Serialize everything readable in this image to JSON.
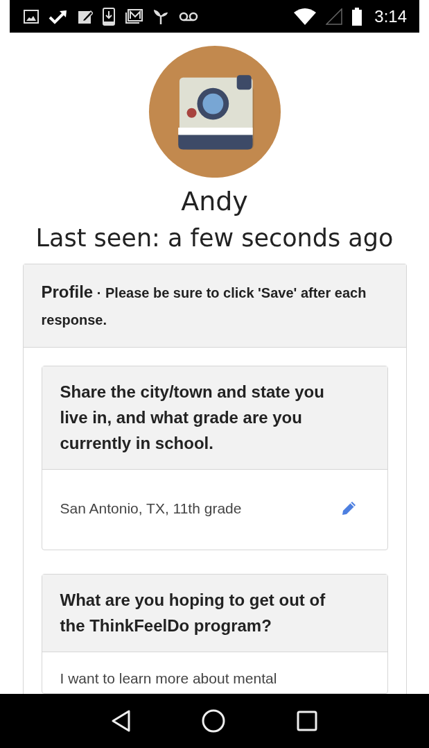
{
  "status_bar": {
    "time": "3:14"
  },
  "user": {
    "name": "Andy",
    "last_seen": "Last seen: a few seconds ago"
  },
  "profile": {
    "title": "Profile",
    "separator": "·",
    "note": "Please be sure to click 'Save' after each response.",
    "questions": [
      {
        "question": "Share the city/town and state you live in, and what grade are you currently in school.",
        "answer": "San Antonio, TX, 11th grade"
      },
      {
        "question": "What are you hoping to get out of the ThinkFeelDo program?",
        "answer": "I want to learn more about mental"
      }
    ]
  }
}
